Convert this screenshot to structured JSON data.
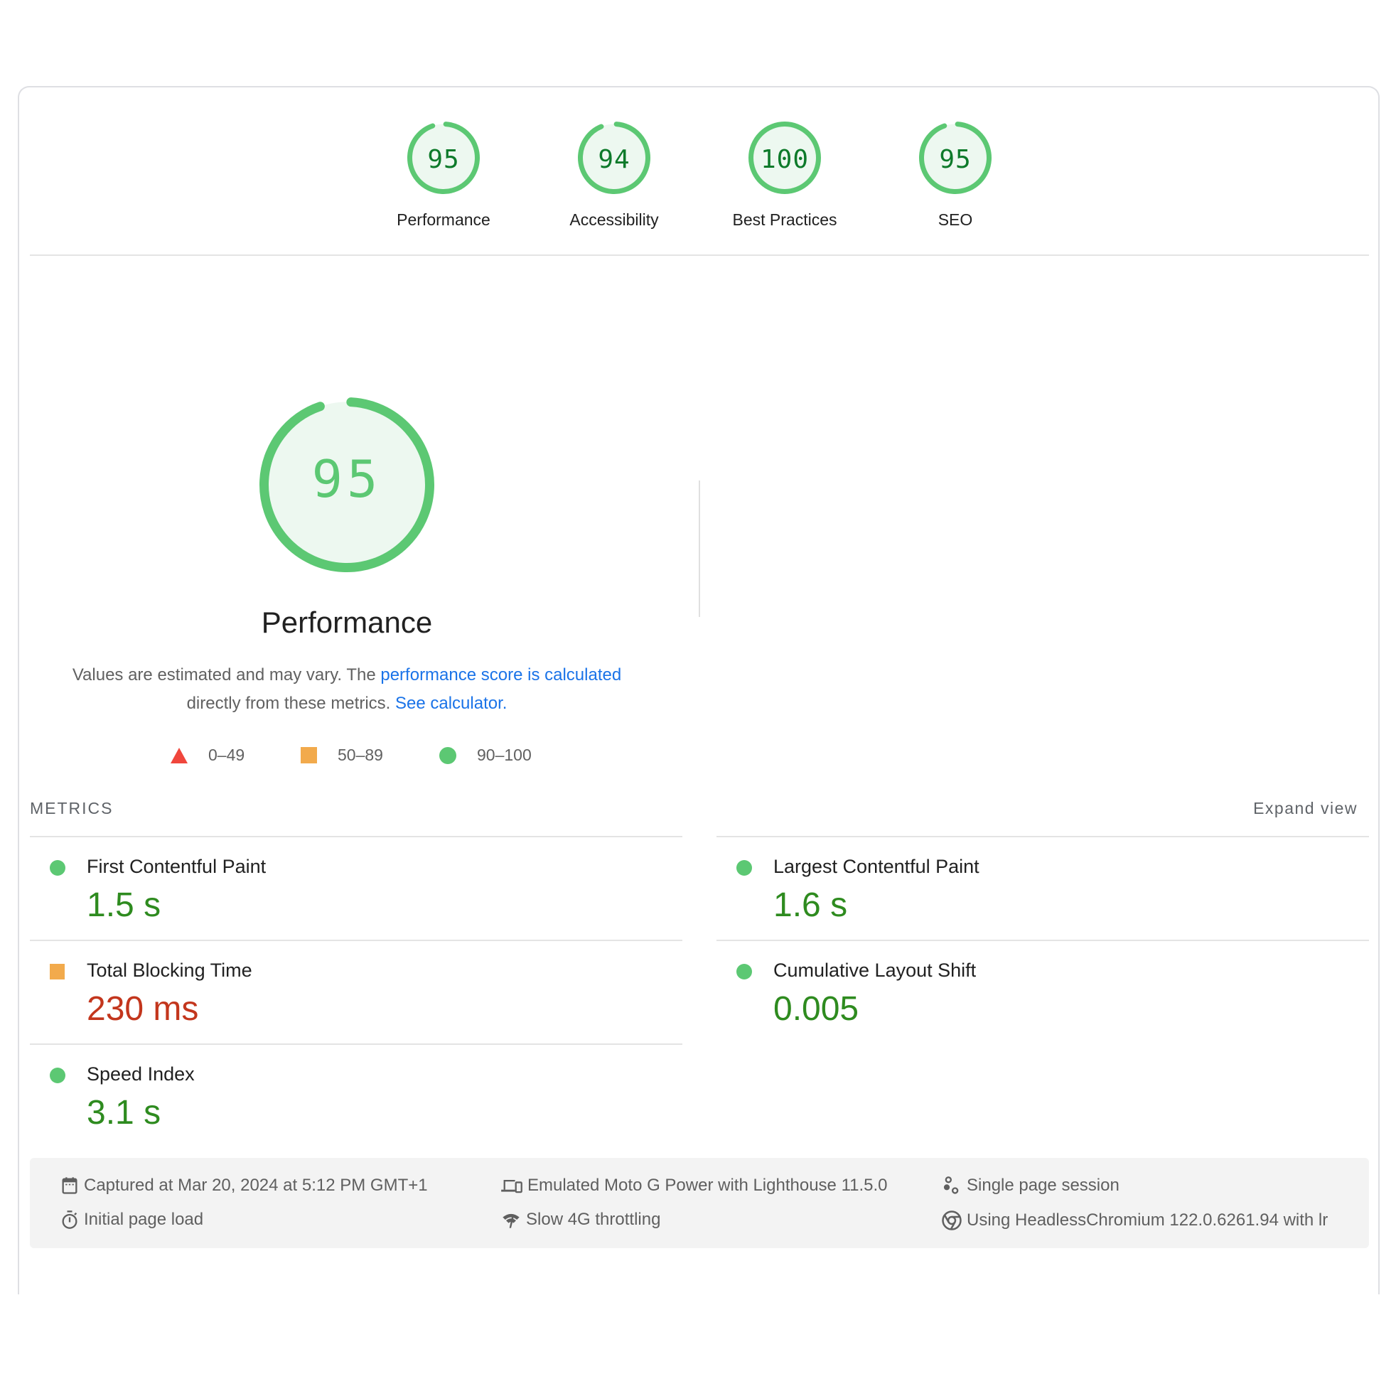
{
  "categories": [
    {
      "label": "Performance",
      "score": "95",
      "fraction": 0.95
    },
    {
      "label": "Accessibility",
      "score": "94",
      "fraction": 0.94
    },
    {
      "label": "Best Practices",
      "score": "100",
      "fraction": 1.0
    },
    {
      "label": "SEO",
      "score": "95",
      "fraction": 0.95
    }
  ],
  "summary": {
    "score": "95",
    "fraction": 0.95,
    "title": "Performance",
    "desc_prefix": "Values are estimated and may vary. The ",
    "desc_link1": "performance score is calculated",
    "desc_middle": " directly from these metrics. ",
    "desc_link2": "See calculator."
  },
  "legend": [
    {
      "range": "0–49",
      "shape": "triangle",
      "color": "#f0463c"
    },
    {
      "range": "50–89",
      "shape": "square",
      "color": "#f2aa4c"
    },
    {
      "range": "90–100",
      "shape": "circle",
      "color": "#5cc873"
    }
  ],
  "metrics": {
    "label": "METRICS",
    "expand_label": "Expand view",
    "items": [
      {
        "title": "First Contentful Paint",
        "value": "1.5 s",
        "rating": "good"
      },
      {
        "title": "Largest Contentful Paint",
        "value": "1.6 s",
        "rating": "good"
      },
      {
        "title": "Total Blocking Time",
        "value": "230 ms",
        "rating": "average"
      },
      {
        "title": "Cumulative Layout Shift",
        "value": "0.005",
        "rating": "good"
      },
      {
        "title": "Speed Index",
        "value": "3.1 s",
        "rating": "good"
      }
    ]
  },
  "info": {
    "captured": "Captured at Mar 20, 2024 at 5:12 PM GMT+1",
    "initial_load": "Initial page load",
    "device": "Emulated Moto G Power with Lighthouse 11.5.0",
    "throttling": "Slow 4G throttling",
    "session": "Single page session",
    "browser": "Using HeadlessChromium 122.0.6261.94 with lr"
  },
  "colors": {
    "good": "#5cc873",
    "good_text": "#2e8b1f",
    "average": "#f2aa4c",
    "average_text": "#c3361d",
    "poor": "#f0463c",
    "gauge_bg": "#edf8f0",
    "link": "#1a73e8"
  }
}
